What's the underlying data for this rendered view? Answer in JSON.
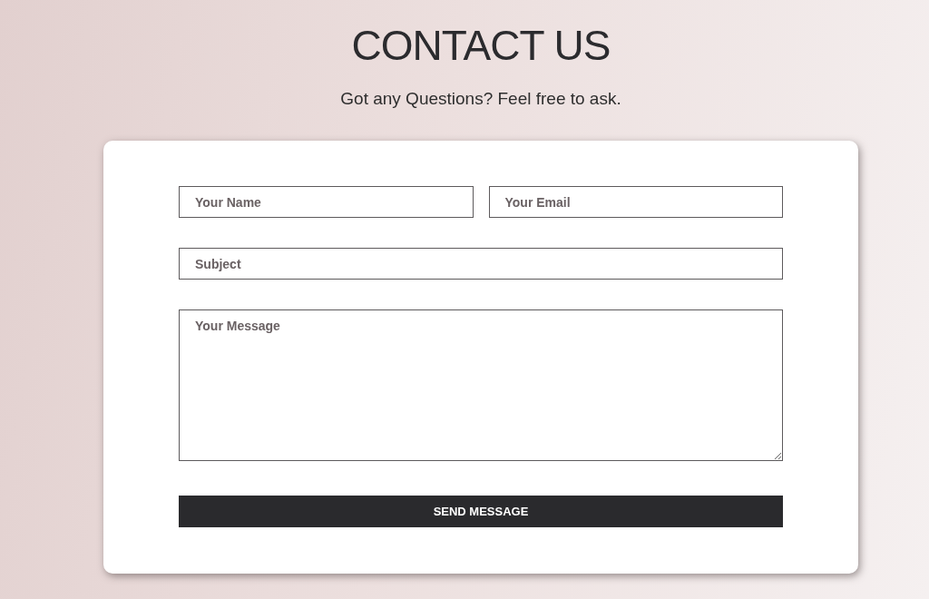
{
  "header": {
    "title": "CONTACT US",
    "subtitle": "Got any Questions? Feel free to ask."
  },
  "form": {
    "rows": [
      [
        {
          "kind": "input",
          "placeholder": "Your Name"
        },
        {
          "kind": "input",
          "placeholder": "Your Email"
        }
      ],
      [
        {
          "kind": "input",
          "placeholder": "Subject"
        }
      ],
      [
        {
          "kind": "textarea",
          "placeholder": "Your Message"
        }
      ]
    ],
    "submit": {
      "label": "SEND MESSAGE"
    }
  }
}
